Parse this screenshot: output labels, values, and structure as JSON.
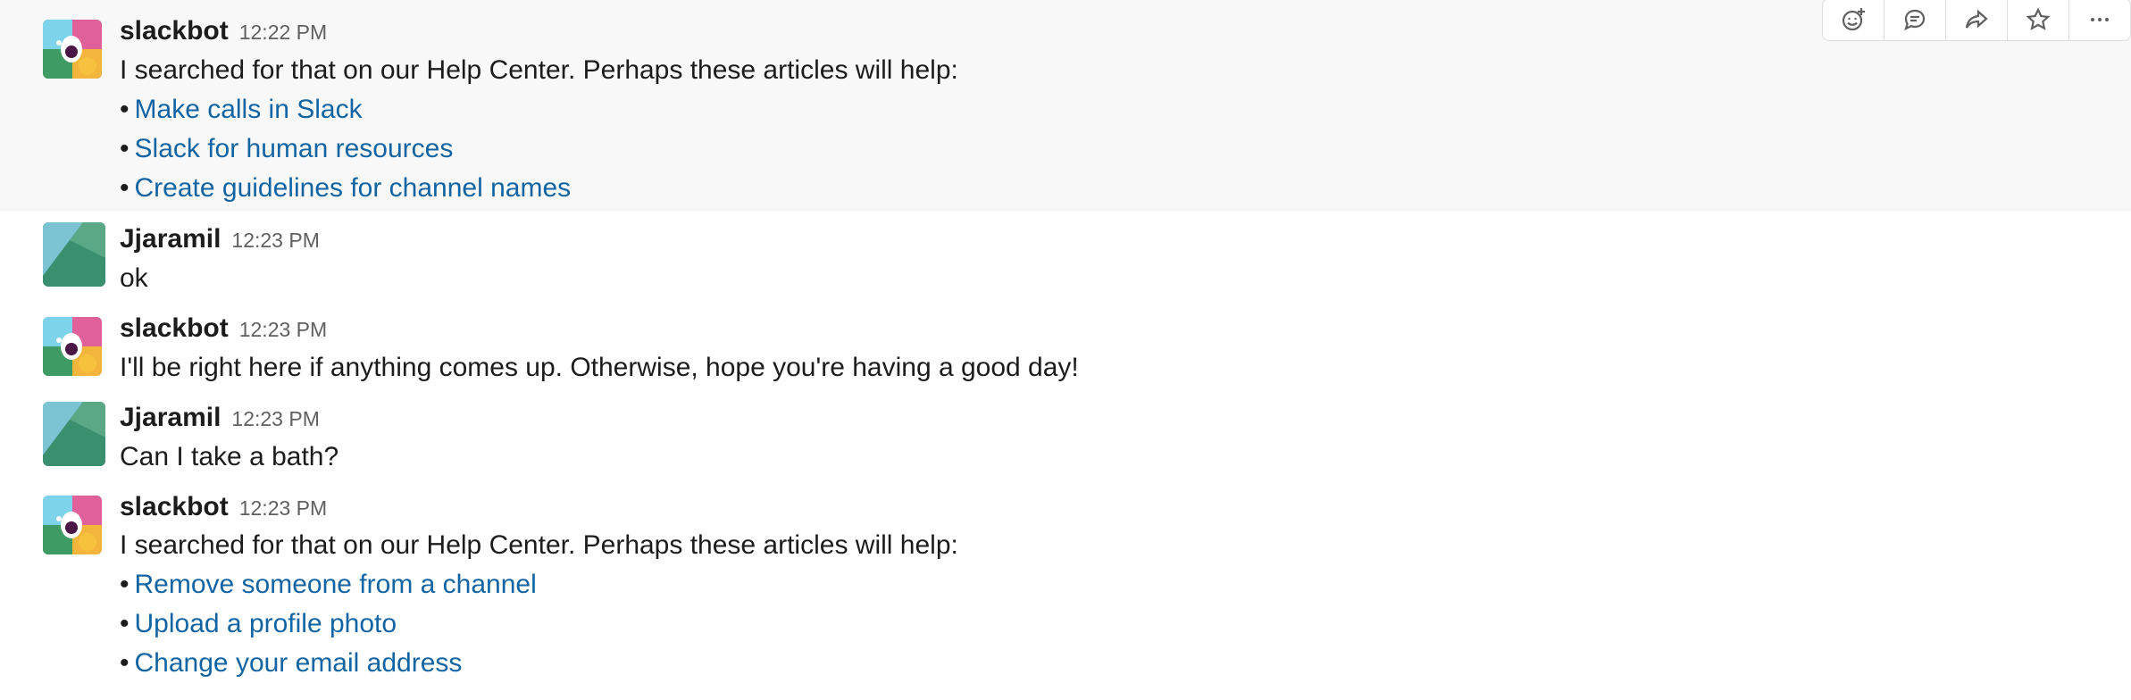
{
  "messages": [
    {
      "author": "slackbot",
      "time": "12:22 PM",
      "text": "I searched for that on our Help Center. Perhaps these articles will help:",
      "links": [
        "Make calls in Slack",
        "Slack for human resources",
        "Create guidelines for channel names"
      ]
    },
    {
      "author": "Jjaramil",
      "time": "12:23 PM",
      "text": "ok"
    },
    {
      "author": "slackbot",
      "time": "12:23 PM",
      "text": "I'll be right here if anything comes up. Otherwise, hope you're having a good day!"
    },
    {
      "author": "Jjaramil",
      "time": "12:23 PM",
      "text": "Can I take a bath?"
    },
    {
      "author": "slackbot",
      "time": "12:23 PM",
      "text": "I searched for that on our Help Center. Perhaps these articles will help:",
      "links": [
        "Remove someone from a channel",
        "Upload a profile photo",
        "Change your email address"
      ]
    }
  ],
  "bullet": "•",
  "actions": {
    "icons": [
      "add-reaction-icon",
      "reply-thread-icon",
      "share-icon",
      "star-icon",
      "more-icon"
    ]
  },
  "colors": {
    "link": "#1264a3",
    "hover_background": "#f8f8f8",
    "timestamp": "#616061"
  }
}
